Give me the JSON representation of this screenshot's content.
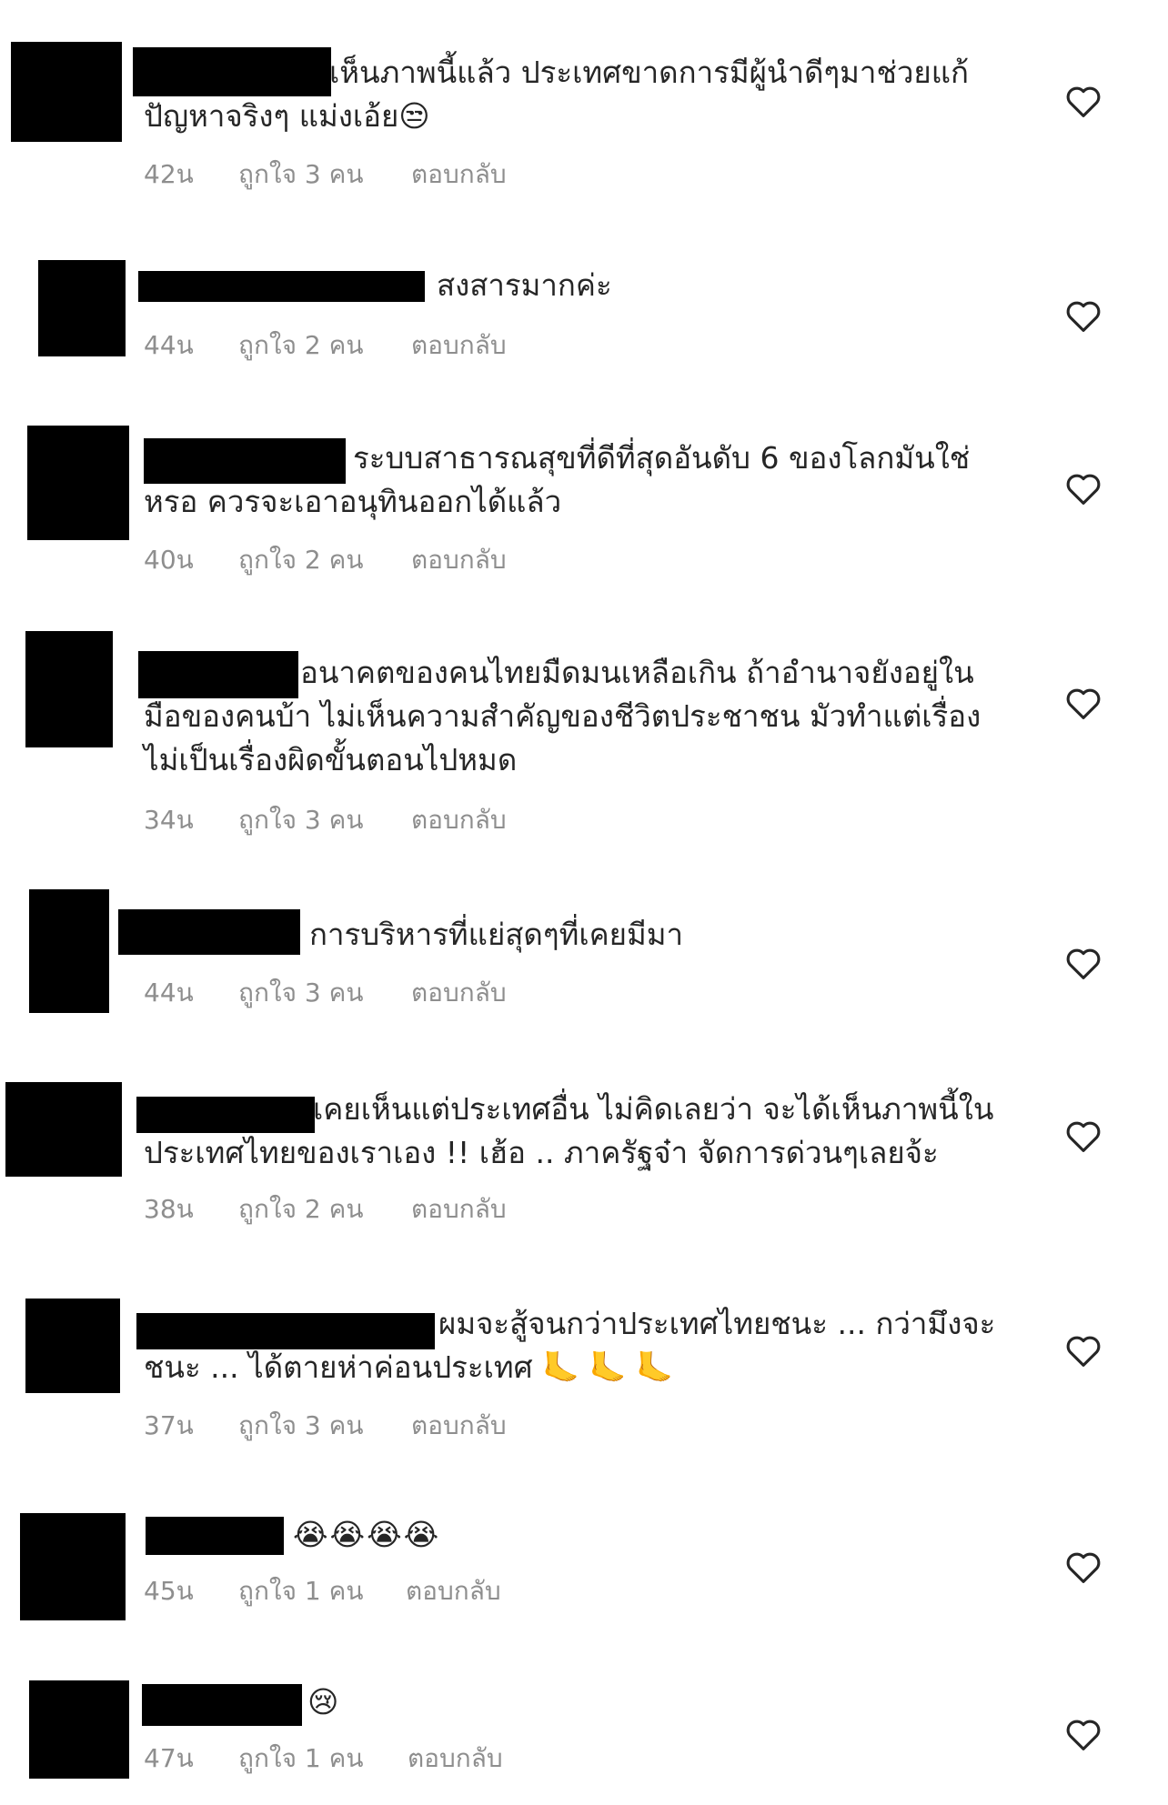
{
  "comments": [
    {
      "text": "เห็นภาพนี้แล้ว ประเทศขาดการมีผู้นำดีๆมาช่วยแก้\nปัญหาจริงๆ แม่งเอ้ย😒",
      "time": "42น",
      "likes": "ถูกใจ 3 คน",
      "reply": "ตอบกลับ"
    },
    {
      "text": "สงสารมากค่ะ",
      "time": "44น",
      "likes": "ถูกใจ 2 คน",
      "reply": "ตอบกลับ"
    },
    {
      "text": "ระบบสาธารณสุขที่ดีที่สุดอันดับ 6 ของโลกมันใช่\nหรอ ควรจะเอาอนุทินออกได้แล้ว",
      "time": "40น",
      "likes": "ถูกใจ 2 คน",
      "reply": "ตอบกลับ"
    },
    {
      "text": "อนาคตของคนไทยมืดมนเหลือเกิน ถ้าอำนาจยังอยู่ใน\nมือของคนบ้า ไม่เห็นความสำคัญของชีวิตประชาชน มัวทำแต่เรื่อง\nไม่เป็นเรื่องผิดขั้นตอนไปหมด",
      "time": "34น",
      "likes": "ถูกใจ 3 คน",
      "reply": "ตอบกลับ"
    },
    {
      "text": "การบริหารที่แย่สุดๆที่เคยมีมา",
      "time": "44น",
      "likes": "ถูกใจ 3 คน",
      "reply": "ตอบกลับ"
    },
    {
      "text": "เคยเห็นแต่ประเทศอื่น ไม่คิดเลยว่า จะได้เห็นภาพนี้ใน\nประเทศไทยของเราเอง !! เฮ้อ .. ภาครัฐจ๋า จัดการด่วนๆเลยจ้ะ",
      "time": "38น",
      "likes": "ถูกใจ 2 คน",
      "reply": "ตอบกลับ"
    },
    {
      "text": "ผมจะสู้จนกว่าประเทศไทยชนะ ... กว่ามึงจะ\nชนะ ... ได้ตายห่าค่อนประเทศ 🦶 🦶 🦶",
      "time": "37น",
      "likes": "ถูกใจ 3 คน",
      "reply": "ตอบกลับ"
    },
    {
      "text": "😭😭😭😭",
      "time": "45น",
      "likes": "ถูกใจ 1 คน",
      "reply": "ตอบกลับ"
    },
    {
      "text": "😢",
      "time": "47น",
      "likes": "ถูกใจ 1 คน",
      "reply": "ตอบกลับ"
    }
  ],
  "icons": {
    "like": "heart-outline-icon"
  },
  "colors": {
    "text": "#262626",
    "meta": "#8e8e8e",
    "redaction": "#000000"
  }
}
